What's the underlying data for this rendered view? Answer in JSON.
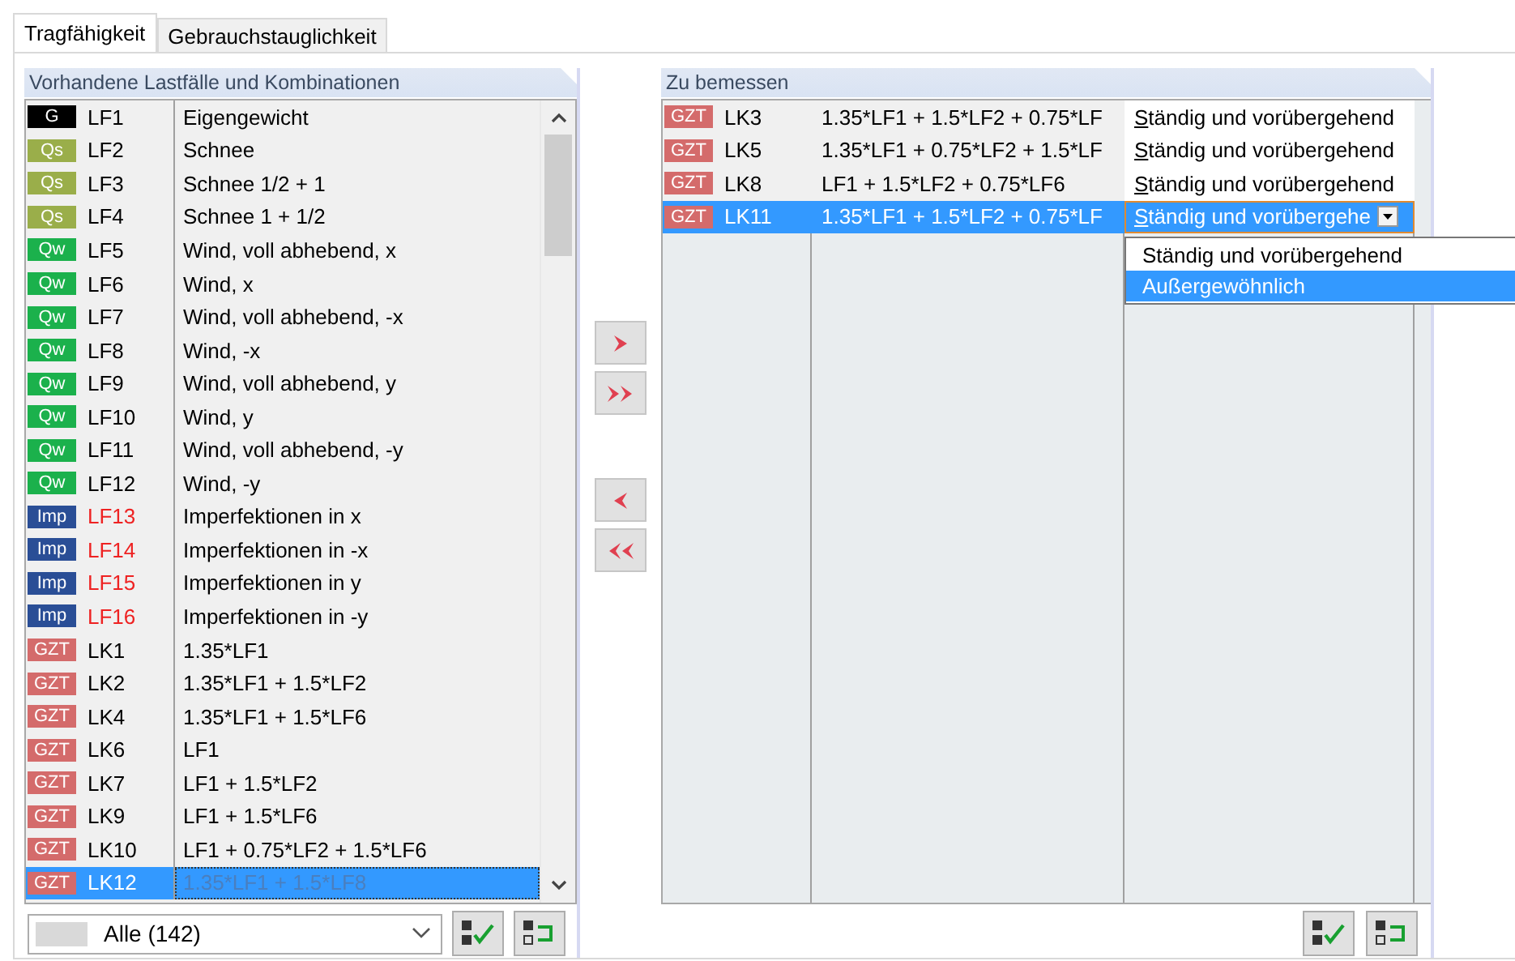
{
  "tabs": [
    {
      "label": "Tragfähigkeit",
      "selected": true
    },
    {
      "label": "Gebrauchstauglichkeit",
      "selected": false
    }
  ],
  "available": {
    "title": "Vorhandene Lastfälle und Kombinationen",
    "rows": [
      {
        "badge": "G",
        "color": "#000000",
        "name": "LF1",
        "flagged": false,
        "description": "Eigengewicht",
        "selected": false
      },
      {
        "badge": "Qs",
        "color": "#9aae4a",
        "name": "LF2",
        "flagged": false,
        "description": "Schnee",
        "selected": false
      },
      {
        "badge": "Qs",
        "color": "#9aae4a",
        "name": "LF3",
        "flagged": false,
        "description": "Schnee 1/2 + 1",
        "selected": false
      },
      {
        "badge": "Qs",
        "color": "#9aae4a",
        "name": "LF4",
        "flagged": false,
        "description": "Schnee 1 + 1/2",
        "selected": false
      },
      {
        "badge": "Qw",
        "color": "#1bb14c",
        "name": "LF5",
        "flagged": false,
        "description": "Wind, voll abhebend, x",
        "selected": false
      },
      {
        "badge": "Qw",
        "color": "#1bb14c",
        "name": "LF6",
        "flagged": false,
        "description": "Wind, x",
        "selected": false
      },
      {
        "badge": "Qw",
        "color": "#1bb14c",
        "name": "LF7",
        "flagged": false,
        "description": "Wind, voll abhebend, -x",
        "selected": false
      },
      {
        "badge": "Qw",
        "color": "#1bb14c",
        "name": "LF8",
        "flagged": false,
        "description": "Wind, -x",
        "selected": false
      },
      {
        "badge": "Qw",
        "color": "#1bb14c",
        "name": "LF9",
        "flagged": false,
        "description": "Wind, voll abhebend, y",
        "selected": false
      },
      {
        "badge": "Qw",
        "color": "#1bb14c",
        "name": "LF10",
        "flagged": false,
        "description": "Wind, y",
        "selected": false
      },
      {
        "badge": "Qw",
        "color": "#1bb14c",
        "name": "LF11",
        "flagged": false,
        "description": "Wind, voll abhebend, -y",
        "selected": false
      },
      {
        "badge": "Qw",
        "color": "#1bb14c",
        "name": "LF12",
        "flagged": false,
        "description": "Wind, -y",
        "selected": false
      },
      {
        "badge": "Imp",
        "color": "#2a4e96",
        "name": "LF13",
        "flagged": true,
        "description": "Imperfektionen in x",
        "selected": false
      },
      {
        "badge": "Imp",
        "color": "#2a4e96",
        "name": "LF14",
        "flagged": true,
        "description": "Imperfektionen in -x",
        "selected": false
      },
      {
        "badge": "Imp",
        "color": "#2a4e96",
        "name": "LF15",
        "flagged": true,
        "description": "Imperfektionen in y",
        "selected": false
      },
      {
        "badge": "Imp",
        "color": "#2a4e96",
        "name": "LF16",
        "flagged": true,
        "description": "Imperfektionen in -y",
        "selected": false
      },
      {
        "badge": "GZT",
        "color": "#d46b6b",
        "name": "LK1",
        "flagged": false,
        "description": "1.35*LF1",
        "selected": false
      },
      {
        "badge": "GZT",
        "color": "#d46b6b",
        "name": "LK2",
        "flagged": false,
        "description": "1.35*LF1 + 1.5*LF2",
        "selected": false
      },
      {
        "badge": "GZT",
        "color": "#d46b6b",
        "name": "LK4",
        "flagged": false,
        "description": "1.35*LF1 + 1.5*LF6",
        "selected": false
      },
      {
        "badge": "GZT",
        "color": "#d46b6b",
        "name": "LK6",
        "flagged": false,
        "description": "LF1",
        "selected": false
      },
      {
        "badge": "GZT",
        "color": "#d46b6b",
        "name": "LK7",
        "flagged": false,
        "description": "LF1 + 1.5*LF2",
        "selected": false
      },
      {
        "badge": "GZT",
        "color": "#d46b6b",
        "name": "LK9",
        "flagged": false,
        "description": "LF1 + 1.5*LF6",
        "selected": false
      },
      {
        "badge": "GZT",
        "color": "#d46b6b",
        "name": "LK10",
        "flagged": false,
        "description": "LF1 + 0.75*LF2 + 1.5*LF6",
        "selected": false
      },
      {
        "badge": "GZT",
        "color": "#d46b6b",
        "name": "LK12",
        "flagged": false,
        "description": "1.35*LF1 + 1.5*LF8",
        "selected": true
      }
    ],
    "filter": {
      "value": "Alle (142)"
    }
  },
  "selected_for_design": {
    "title": "Zu bemessen",
    "rows": [
      {
        "badge": "GZT",
        "color": "#d46b6b",
        "name": "LK3",
        "formula": "1.35*LF1 + 1.5*LF2 + 0.75*LF",
        "situation": "Ständig und vorübergehend",
        "selected": false
      },
      {
        "badge": "GZT",
        "color": "#d46b6b",
        "name": "LK5",
        "formula": "1.35*LF1 + 0.75*LF2 + 1.5*LF",
        "situation": "Ständig und vorübergehend",
        "selected": false
      },
      {
        "badge": "GZT",
        "color": "#d46b6b",
        "name": "LK8",
        "formula": "LF1 + 1.5*LF2 + 0.75*LF6",
        "situation": "Ständig und vorübergehend",
        "selected": false
      },
      {
        "badge": "GZT",
        "color": "#d46b6b",
        "name": "LK11",
        "formula": "1.35*LF1 + 1.5*LF2 + 0.75*LF",
        "situation": "Ständig und vorübergehe",
        "selected": true
      }
    ],
    "dropdown": {
      "expanded": true,
      "options": [
        {
          "label": "Ständig und vorübergehend",
          "selected": false
        },
        {
          "label": "Außergewöhnlich",
          "selected": true
        }
      ]
    }
  }
}
